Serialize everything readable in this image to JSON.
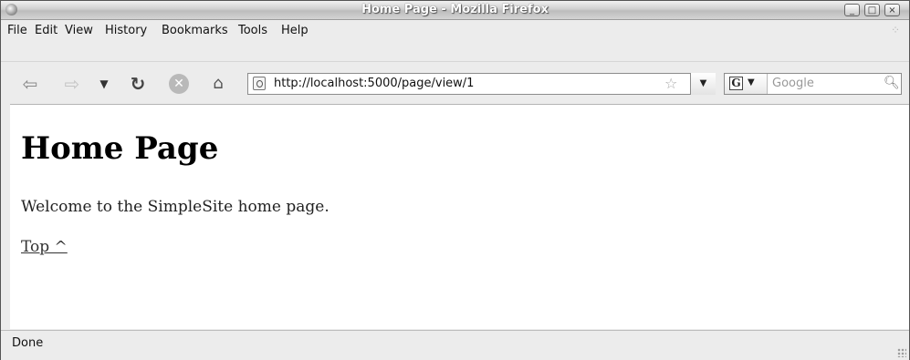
{
  "window": {
    "title": "Home Page - Mozilla Firefox"
  },
  "menu": {
    "file": "File",
    "edit": "Edit",
    "view": "View",
    "history": "History",
    "bookmarks": "Bookmarks",
    "tools": "Tools",
    "help": "Help"
  },
  "toolbar": {
    "icons": [
      "back-icon",
      "forward-icon",
      "history-dropdown-icon",
      "reload-icon",
      "stop-icon",
      "home-icon"
    ]
  },
  "urlbar": {
    "value": "http://localhost:5000/page/view/1"
  },
  "search": {
    "engine_icon": "google-icon",
    "placeholder": "Google"
  },
  "page": {
    "heading": "Home Page",
    "welcome": "Welcome to the SimpleSite home page.",
    "top_link": "Top ^"
  },
  "status": {
    "text": "Done"
  },
  "colors": {
    "chrome_background": "#ececec",
    "content_background": "#ffffff",
    "title_text": "#ffffff"
  }
}
